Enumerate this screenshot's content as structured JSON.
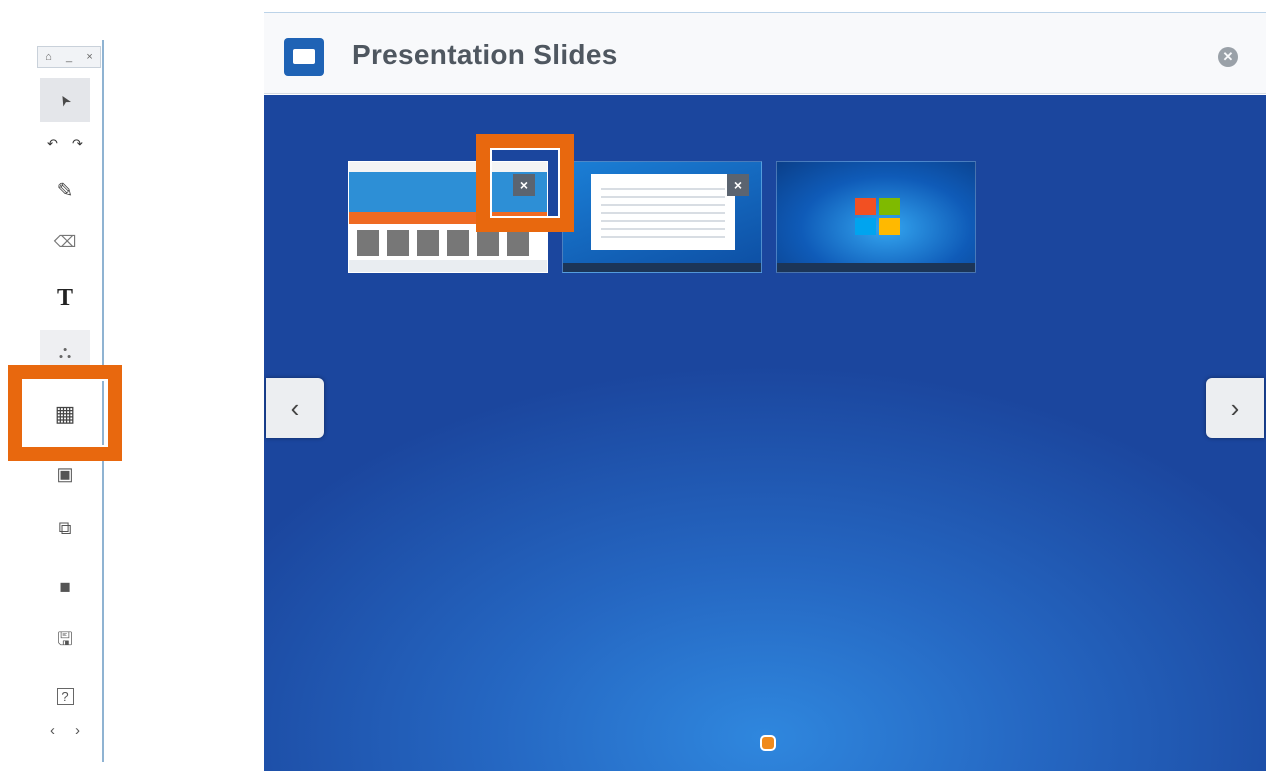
{
  "toolbar": {
    "header_icons": [
      "home-icon",
      "minimize-icon",
      "close-icon"
    ],
    "header_glyphs": [
      "⌂",
      "_",
      "×"
    ],
    "tools": [
      {
        "name": "select-tool",
        "icon": "pointer-icon",
        "glyph": "➤"
      },
      {
        "name": "pen-tool",
        "icon": "pencil-icon",
        "glyph": "✎"
      },
      {
        "name": "eraser-tool",
        "icon": "eraser-icon",
        "glyph": "⌫"
      },
      {
        "name": "text-tool",
        "icon": "text-icon",
        "glyph": "T"
      },
      {
        "name": "shapes-tool",
        "icon": "shapes-icon",
        "glyph": "⛬"
      },
      {
        "name": "slides-tool",
        "icon": "grid-icon",
        "glyph": "▦"
      },
      {
        "name": "image-tool",
        "icon": "image-icon",
        "glyph": "▣"
      },
      {
        "name": "screenshot-tool",
        "icon": "screen-capture-icon",
        "glyph": "⧉"
      },
      {
        "name": "video-tool",
        "icon": "video-camera-icon",
        "glyph": "◼"
      },
      {
        "name": "save-tool",
        "icon": "floppy-disk-icon",
        "glyph": "🖫"
      },
      {
        "name": "help-tool",
        "icon": "help-icon",
        "glyph": "?"
      }
    ],
    "undo_glyph": "↶",
    "redo_glyph": "↷",
    "prev_glyph": "‹",
    "next_glyph": "›"
  },
  "panel": {
    "title": "Presentation Slides",
    "close_glyph": "✕",
    "slides": [
      {
        "name": "website",
        "remove_glyph": "×"
      },
      {
        "name": "explorer",
        "remove_glyph": "×"
      },
      {
        "name": "desktop"
      }
    ],
    "prev_glyph": "‹",
    "next_glyph": "›",
    "page_count": 1,
    "current_page": 1
  },
  "colors": {
    "highlight": "#e8680e",
    "panel_blue": "#2567c2",
    "page_dot": "#f08a1c"
  }
}
